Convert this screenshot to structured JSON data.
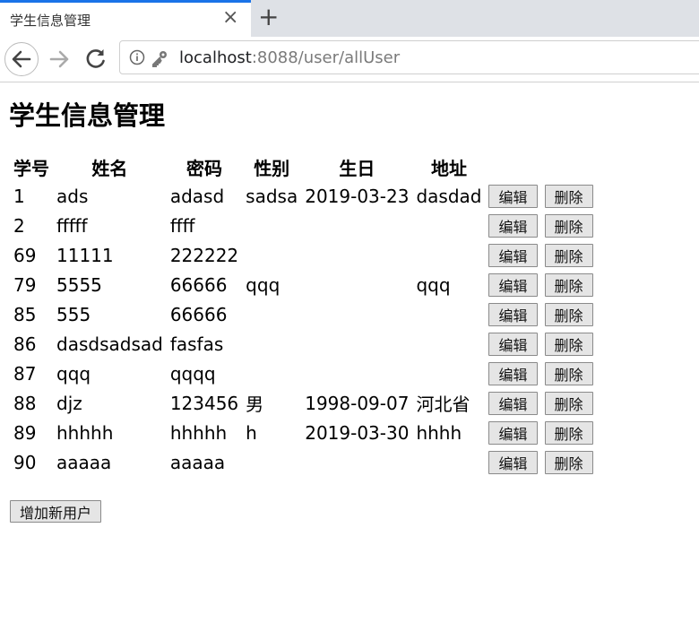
{
  "browser": {
    "tab_title": "学生信息管理",
    "tab_close": "×",
    "new_tab": "+",
    "url_host": "localhost",
    "url_rest": ":8088/user/allUser"
  },
  "page": {
    "title": "学生信息管理",
    "add_button": "增加新用户"
  },
  "table": {
    "headers": [
      "学号",
      "姓名",
      "密码",
      "性别",
      "生日",
      "地址"
    ],
    "edit_label": "编辑",
    "delete_label": "删除",
    "rows": [
      [
        "1",
        "ads",
        "adasd",
        "sadsa",
        "2019-03-23",
        "dasdad"
      ],
      [
        "2",
        "fffff",
        "ffff",
        "",
        "",
        ""
      ],
      [
        "69",
        "11111",
        "222222",
        "",
        "",
        ""
      ],
      [
        "79",
        "5555",
        "66666",
        "qqq",
        "",
        "qqq"
      ],
      [
        "85",
        "555",
        "66666",
        "",
        "",
        ""
      ],
      [
        "86",
        "dasdsadsad",
        "fasfas",
        "",
        "",
        ""
      ],
      [
        "87",
        "qqq",
        "qqqq",
        "",
        "",
        ""
      ],
      [
        "88",
        "djz",
        "123456",
        "男",
        "1998-09-07",
        "河北省"
      ],
      [
        "89",
        "hhhhh",
        "hhhhh",
        "h",
        "2019-03-30",
        "hhhh"
      ],
      [
        "90",
        "aaaaa",
        "aaaaa",
        "",
        "",
        ""
      ]
    ]
  }
}
